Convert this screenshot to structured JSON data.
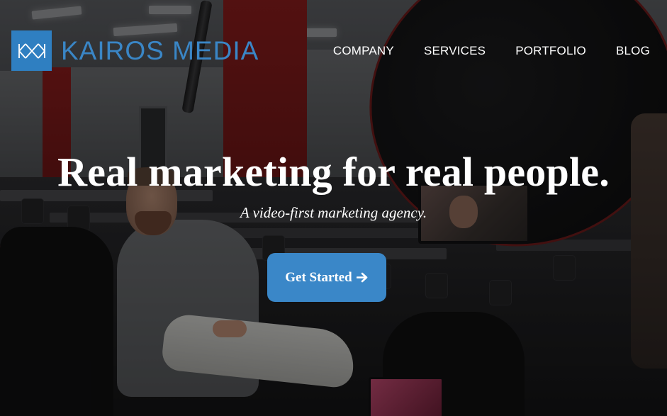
{
  "brand": {
    "name": "KAIROS MEDIA",
    "logo_icon": "km-monogram-icon",
    "accent_color": "#3a87c8"
  },
  "nav": {
    "items": [
      {
        "label": "COMPANY"
      },
      {
        "label": "SERVICES"
      },
      {
        "label": "PORTFOLIO"
      },
      {
        "label": "BLOG"
      }
    ]
  },
  "hero": {
    "headline": "Real marketing for real people.",
    "subheadline": "A video-first marketing agency.",
    "cta_label": "Get Started",
    "cta_icon": "arrow-right-icon",
    "background_image": "video-shoot-photo"
  }
}
